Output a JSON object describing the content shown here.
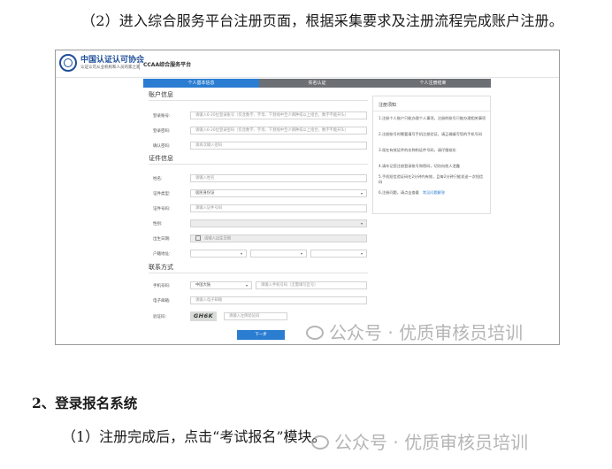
{
  "doc": {
    "para1": "（2）进入综合服务平台注册页面，根据采集要求及注册流程完成账户注册。",
    "heading2": "2、登录报名系统",
    "para2": "（1）注册完成后，点击“考试报名”模块。",
    "watermark": "公众号 · 优质审核员培训"
  },
  "screenshot": {
    "org_name": "中国认证认可协会",
    "org_slogan": "认证认可从业机构和人员的家之家",
    "platform_name": "CCAA综合服务平台",
    "steps": [
      "个人基本信息",
      "实名认证",
      "个人注册结束"
    ],
    "account_section": "账户信息",
    "account_fields": [
      {
        "label": "登录账号:",
        "placeholder": "请输入6-20位登录账号（仅含数字、字母、下划线中至少两种或以上组合，数字不能开头）"
      },
      {
        "label": "登录密码:",
        "placeholder": "请输入6-20位登录密码（仅含数字、字母、下划线中至少两种或以上组合，数字不能开头）"
      },
      {
        "label": "确认密码:",
        "placeholder": "请再次输入密码"
      }
    ],
    "id_section": "证件信息",
    "id_fields": [
      {
        "label": "姓名:",
        "placeholder": "请输入姓名"
      },
      {
        "label": "证件类型:",
        "placeholder": "居民身份证"
      },
      {
        "label": "证件号码:",
        "placeholder": "请输入证件号码"
      },
      {
        "label": "性别:",
        "placeholder": ""
      },
      {
        "label": "出生日期:",
        "placeholder": "请输入出生日期"
      },
      {
        "label": "户籍地址:",
        "placeholder": ""
      }
    ],
    "contact_section": "联系方式",
    "phone_label": "手机号码:",
    "phone_region": "中国大陆",
    "phone_placeholder": "请输入手机号码（无需填写区号）",
    "email_label": "电子邮箱:",
    "email_placeholder": "请输入电子邮箱",
    "captcha_label": "验证码:",
    "captcha_text": "GH6K",
    "captcha_placeholder": "请输入左侧验证码",
    "submit_label": "下一步",
    "notice_title": "注册须知",
    "notice_items": [
      "1.注册个人账户只能办理个人事项，注册的账号只能办理相关事项",
      "2.注册账号时需要填写手机注册验证，请正确填写您的手机号码",
      "3.现在有效证件的名称和证件号码，请仔细核实",
      "4.请牢记您注册登录账号和密码，切勿向他人泄露",
      "5.手机短信验证码在2分钟内有效，且每2分钟只能发送一次短信码",
      "6.注册问题，请点击查看"
    ],
    "notice_link": "常见问题解答"
  }
}
